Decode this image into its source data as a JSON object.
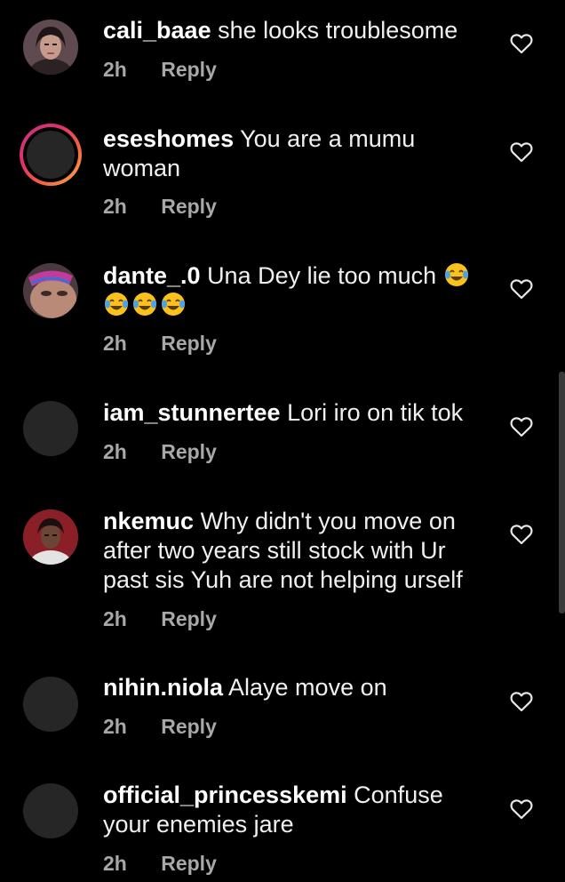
{
  "comments": [
    {
      "username": "cali_baae",
      "text": "she looks troublesome",
      "time": "2h",
      "reply_label": "Reply",
      "avatar": "photo"
    },
    {
      "username": "eseshomes",
      "text": "You are a mumu woman",
      "time": "2h",
      "reply_label": "Reply",
      "avatar": "story-ring"
    },
    {
      "username": "dante_.0",
      "text": "Una Dey lie too much",
      "time": "2h",
      "reply_label": "Reply",
      "avatar": "photo",
      "emojis": [
        "face-with-tears-of-joy",
        "face-with-tears-of-joy",
        "face-with-tears-of-joy",
        "face-with-tears-of-joy"
      ]
    },
    {
      "username": "iam_stunnertee",
      "text": "Lori iro on tik tok",
      "time": "2h",
      "reply_label": "Reply",
      "avatar": "blank"
    },
    {
      "username": "nkemuc",
      "text": "Why didn't you move on after two years still stock with Ur past sis Yuh are not helping urself",
      "time": "2h",
      "reply_label": "Reply",
      "avatar": "photo"
    },
    {
      "username": "nihin.niola",
      "text": "Alaye move on",
      "time": "2h",
      "reply_label": "Reply",
      "avatar": "blank"
    },
    {
      "username": "official_princesskemi",
      "text": "Confuse your enemies jare",
      "time": "2h",
      "reply_label": "Reply",
      "avatar": "blank"
    }
  ],
  "icons": {
    "like": "heart-outline-icon",
    "emoji": "face-with-tears-of-joy"
  },
  "colors": {
    "background": "#000000",
    "text": "#f0f0f0",
    "meta": "#a8a8a8",
    "avatar_placeholder": "#262626"
  }
}
